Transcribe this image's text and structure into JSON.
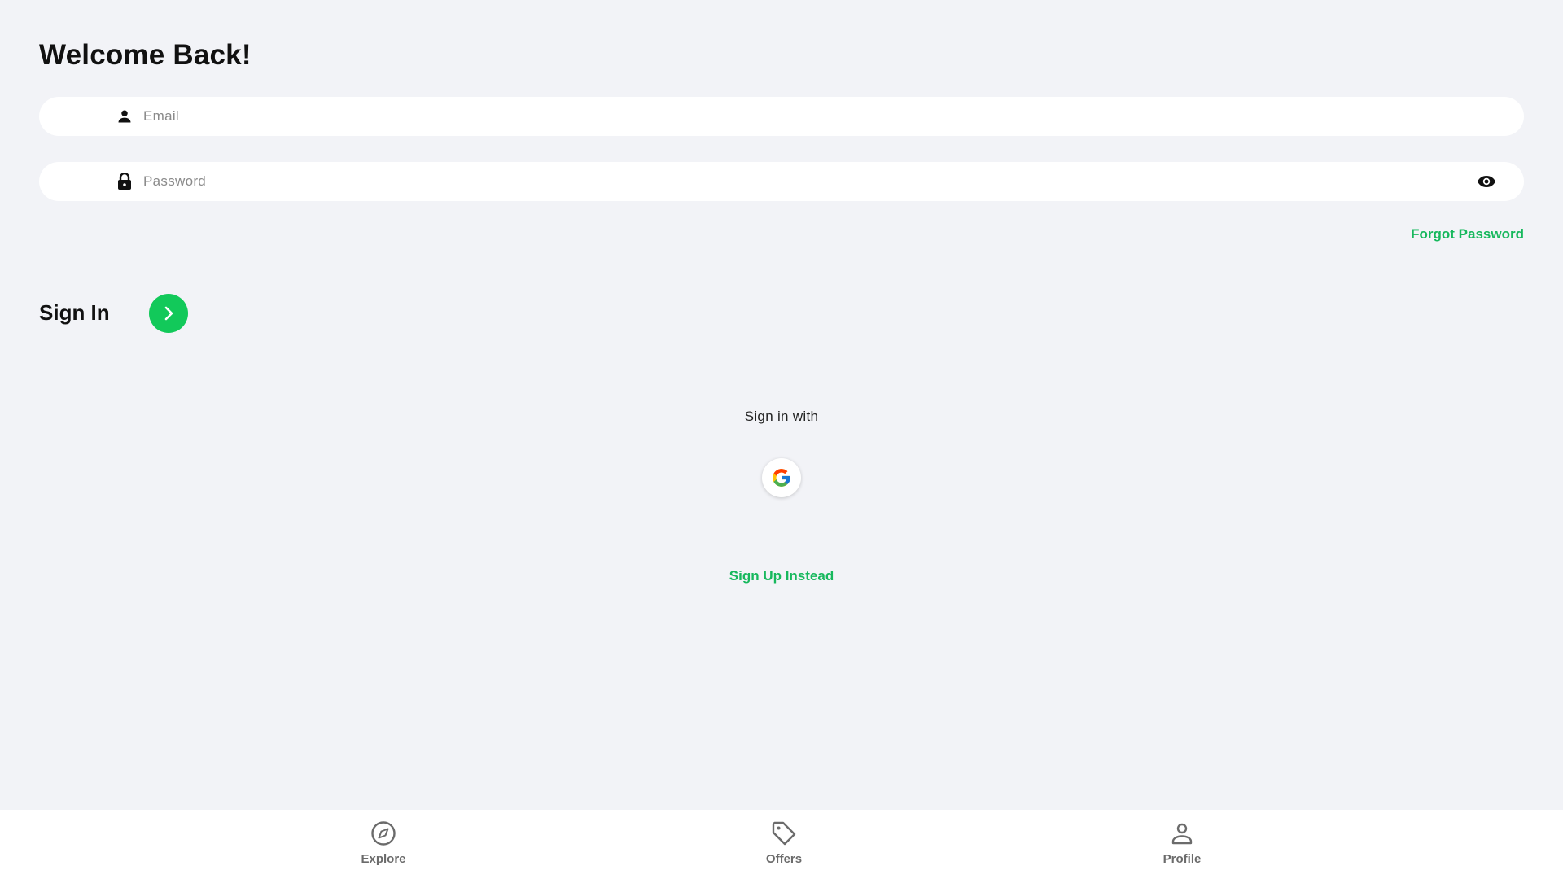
{
  "header": {
    "title": "Welcome Back!"
  },
  "form": {
    "email": {
      "placeholder": "Email",
      "value": "",
      "icon": "person-icon"
    },
    "password": {
      "placeholder": "Password",
      "value": "",
      "icon": "lock-icon",
      "toggle_icon": "eye-icon"
    },
    "forgot_label": "Forgot Password",
    "signin_label": "Sign In",
    "signin_icon": "chevron-right-icon"
  },
  "social": {
    "label": "Sign in with",
    "providers": [
      {
        "name": "google",
        "icon": "google-icon"
      }
    ]
  },
  "signup_label": "Sign Up Instead",
  "bottom_nav": {
    "items": [
      {
        "label": "Explore",
        "icon": "compass-icon"
      },
      {
        "label": "Offers",
        "icon": "tag-icon"
      },
      {
        "label": "Profile",
        "icon": "person-outline-icon"
      }
    ]
  },
  "colors": {
    "accent": "#12c95a",
    "link": "#17b85d",
    "background": "#f2f3f7",
    "surface": "#ffffff",
    "nav_inactive": "#6b6b6b"
  }
}
